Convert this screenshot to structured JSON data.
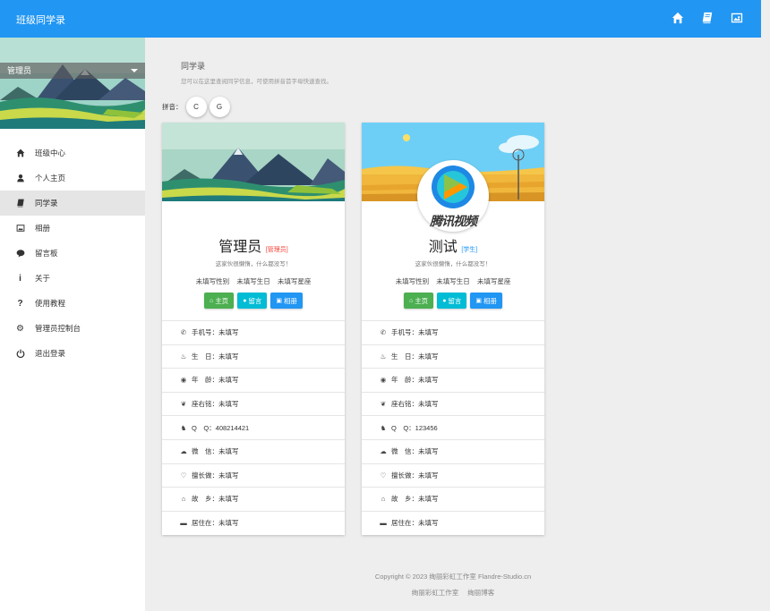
{
  "header": {
    "title": "班级同学录",
    "icons": [
      "home-icon",
      "book-icon",
      "picture-icon"
    ]
  },
  "sidebar": {
    "user": "管理员",
    "items": [
      {
        "label": "班级中心",
        "icon": "home-icon"
      },
      {
        "label": "个人主页",
        "icon": "user-icon"
      },
      {
        "label": "同学录",
        "icon": "book-icon",
        "active": true
      },
      {
        "label": "相册",
        "icon": "picture-icon"
      },
      {
        "label": "留言板",
        "icon": "comment-icon"
      },
      {
        "label": "关于",
        "icon": "info-icon"
      },
      {
        "label": "使用教程",
        "icon": "question-icon"
      },
      {
        "label": "管理员控制台",
        "icon": "gear-icon"
      },
      {
        "label": "退出登录",
        "icon": "power-icon"
      }
    ]
  },
  "page": {
    "title": "同学录",
    "description": "您可以在这里查阅同学信息，可使用拼音首字母快速查找。",
    "pinyin_label": "拼音：",
    "letters": [
      "C",
      "G"
    ]
  },
  "cards": [
    {
      "name": "管理员",
      "role": "[管理员]",
      "role_color": "#f44336",
      "signature": "这家伙很懒惰，什么都没写！",
      "tags": [
        "未填写性别",
        "未填写生日",
        "未填写星座"
      ],
      "buttons": [
        "主页",
        "留言",
        "相册"
      ],
      "rows": [
        {
          "icon": "phone-icon",
          "label": "手机号：",
          "value": "未填写"
        },
        {
          "icon": "cake-icon",
          "label": "生　日：",
          "value": "未填写"
        },
        {
          "icon": "globe-icon",
          "label": "年　龄：",
          "value": "未填写"
        },
        {
          "icon": "leaf-icon",
          "label": "座右铭：",
          "value": "未填写"
        },
        {
          "icon": "qq-icon",
          "label": "Q　Q：",
          "value": "408214421"
        },
        {
          "icon": "wechat-icon",
          "label": "微　信：",
          "value": "未填写"
        },
        {
          "icon": "heart-icon",
          "label": "擅长做：",
          "value": "未填写"
        },
        {
          "icon": "home-icon",
          "label": "故　乡：",
          "value": "未填写"
        },
        {
          "icon": "bed-icon",
          "label": "居住在：",
          "value": "未填写"
        }
      ]
    },
    {
      "name": "测试",
      "role": "[学生]",
      "role_color": "#2196f3",
      "signature": "这家伙很懒惰，什么都没写！",
      "tags": [
        "未填写性别",
        "未填写生日",
        "未填写星座"
      ],
      "buttons": [
        "主页",
        "留言",
        "相册"
      ],
      "avatar_text": "腾讯视频",
      "rows": [
        {
          "icon": "phone-icon",
          "label": "手机号：",
          "value": "未填写"
        },
        {
          "icon": "cake-icon",
          "label": "生　日：",
          "value": "未填写"
        },
        {
          "icon": "globe-icon",
          "label": "年　龄：",
          "value": "未填写"
        },
        {
          "icon": "leaf-icon",
          "label": "座右铭：",
          "value": "未填写"
        },
        {
          "icon": "qq-icon",
          "label": "Q　Q：",
          "value": "123456"
        },
        {
          "icon": "wechat-icon",
          "label": "微　信：",
          "value": "未填写"
        },
        {
          "icon": "heart-icon",
          "label": "擅长做：",
          "value": "未填写"
        },
        {
          "icon": "home-icon",
          "label": "故　乡：",
          "value": "未填写"
        },
        {
          "icon": "bed-icon",
          "label": "居住在：",
          "value": "未填写"
        }
      ]
    }
  ],
  "footer": {
    "copyright": "Copyright © 2023 绚丽彩虹工作室 Flandre-Studio.cn",
    "links": [
      "绚丽彩虹工作室",
      "绚丽博客"
    ]
  }
}
